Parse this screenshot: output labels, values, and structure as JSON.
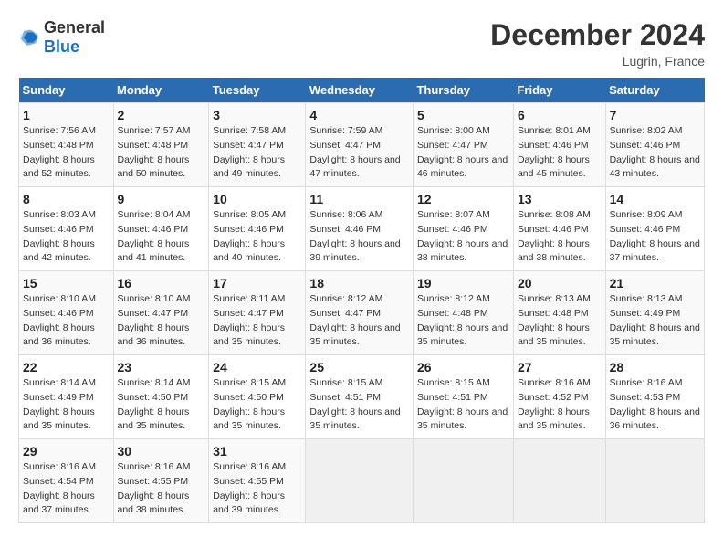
{
  "header": {
    "logo_general": "General",
    "logo_blue": "Blue",
    "main_title": "December 2024",
    "subtitle": "Lugrin, France"
  },
  "days_of_week": [
    "Sunday",
    "Monday",
    "Tuesday",
    "Wednesday",
    "Thursday",
    "Friday",
    "Saturday"
  ],
  "weeks": [
    [
      {
        "day": "1",
        "sunrise": "7:56 AM",
        "sunset": "4:48 PM",
        "daylight": "8 hours and 52 minutes."
      },
      {
        "day": "2",
        "sunrise": "7:57 AM",
        "sunset": "4:48 PM",
        "daylight": "8 hours and 50 minutes."
      },
      {
        "day": "3",
        "sunrise": "7:58 AM",
        "sunset": "4:47 PM",
        "daylight": "8 hours and 49 minutes."
      },
      {
        "day": "4",
        "sunrise": "7:59 AM",
        "sunset": "4:47 PM",
        "daylight": "8 hours and 47 minutes."
      },
      {
        "day": "5",
        "sunrise": "8:00 AM",
        "sunset": "4:47 PM",
        "daylight": "8 hours and 46 minutes."
      },
      {
        "day": "6",
        "sunrise": "8:01 AM",
        "sunset": "4:46 PM",
        "daylight": "8 hours and 45 minutes."
      },
      {
        "day": "7",
        "sunrise": "8:02 AM",
        "sunset": "4:46 PM",
        "daylight": "8 hours and 43 minutes."
      }
    ],
    [
      {
        "day": "8",
        "sunrise": "8:03 AM",
        "sunset": "4:46 PM",
        "daylight": "8 hours and 42 minutes."
      },
      {
        "day": "9",
        "sunrise": "8:04 AM",
        "sunset": "4:46 PM",
        "daylight": "8 hours and 41 minutes."
      },
      {
        "day": "10",
        "sunrise": "8:05 AM",
        "sunset": "4:46 PM",
        "daylight": "8 hours and 40 minutes."
      },
      {
        "day": "11",
        "sunrise": "8:06 AM",
        "sunset": "4:46 PM",
        "daylight": "8 hours and 39 minutes."
      },
      {
        "day": "12",
        "sunrise": "8:07 AM",
        "sunset": "4:46 PM",
        "daylight": "8 hours and 38 minutes."
      },
      {
        "day": "13",
        "sunrise": "8:08 AM",
        "sunset": "4:46 PM",
        "daylight": "8 hours and 38 minutes."
      },
      {
        "day": "14",
        "sunrise": "8:09 AM",
        "sunset": "4:46 PM",
        "daylight": "8 hours and 37 minutes."
      }
    ],
    [
      {
        "day": "15",
        "sunrise": "8:10 AM",
        "sunset": "4:46 PM",
        "daylight": "8 hours and 36 minutes."
      },
      {
        "day": "16",
        "sunrise": "8:10 AM",
        "sunset": "4:47 PM",
        "daylight": "8 hours and 36 minutes."
      },
      {
        "day": "17",
        "sunrise": "8:11 AM",
        "sunset": "4:47 PM",
        "daylight": "8 hours and 35 minutes."
      },
      {
        "day": "18",
        "sunrise": "8:12 AM",
        "sunset": "4:47 PM",
        "daylight": "8 hours and 35 minutes."
      },
      {
        "day": "19",
        "sunrise": "8:12 AM",
        "sunset": "4:48 PM",
        "daylight": "8 hours and 35 minutes."
      },
      {
        "day": "20",
        "sunrise": "8:13 AM",
        "sunset": "4:48 PM",
        "daylight": "8 hours and 35 minutes."
      },
      {
        "day": "21",
        "sunrise": "8:13 AM",
        "sunset": "4:49 PM",
        "daylight": "8 hours and 35 minutes."
      }
    ],
    [
      {
        "day": "22",
        "sunrise": "8:14 AM",
        "sunset": "4:49 PM",
        "daylight": "8 hours and 35 minutes."
      },
      {
        "day": "23",
        "sunrise": "8:14 AM",
        "sunset": "4:50 PM",
        "daylight": "8 hours and 35 minutes."
      },
      {
        "day": "24",
        "sunrise": "8:15 AM",
        "sunset": "4:50 PM",
        "daylight": "8 hours and 35 minutes."
      },
      {
        "day": "25",
        "sunrise": "8:15 AM",
        "sunset": "4:51 PM",
        "daylight": "8 hours and 35 minutes."
      },
      {
        "day": "26",
        "sunrise": "8:15 AM",
        "sunset": "4:51 PM",
        "daylight": "8 hours and 35 minutes."
      },
      {
        "day": "27",
        "sunrise": "8:16 AM",
        "sunset": "4:52 PM",
        "daylight": "8 hours and 35 minutes."
      },
      {
        "day": "28",
        "sunrise": "8:16 AM",
        "sunset": "4:53 PM",
        "daylight": "8 hours and 36 minutes."
      }
    ],
    [
      {
        "day": "29",
        "sunrise": "8:16 AM",
        "sunset": "4:54 PM",
        "daylight": "8 hours and 37 minutes."
      },
      {
        "day": "30",
        "sunrise": "8:16 AM",
        "sunset": "4:55 PM",
        "daylight": "8 hours and 38 minutes."
      },
      {
        "day": "31",
        "sunrise": "8:16 AM",
        "sunset": "4:55 PM",
        "daylight": "8 hours and 39 minutes."
      },
      null,
      null,
      null,
      null
    ]
  ]
}
